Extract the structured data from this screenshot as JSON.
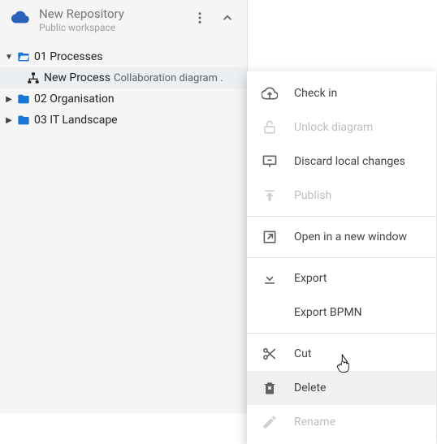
{
  "header": {
    "title": "New Repository",
    "subtitle": "Public workspace"
  },
  "tree": {
    "items": [
      {
        "label": "01 Processes"
      },
      {
        "label": "New Process",
        "suffix": "Collaboration diagram ."
      },
      {
        "label": "02 Organisation"
      },
      {
        "label": "03 IT Landscape"
      }
    ]
  },
  "menu": {
    "check_in": "Check in",
    "unlock": "Unlock diagram",
    "discard": "Discard local changes",
    "publish": "Publish",
    "open_window": "Open in a new window",
    "export": "Export",
    "export_bpmn": "Export BPMN",
    "cut": "Cut",
    "delete": "Delete",
    "rename": "Rename"
  }
}
